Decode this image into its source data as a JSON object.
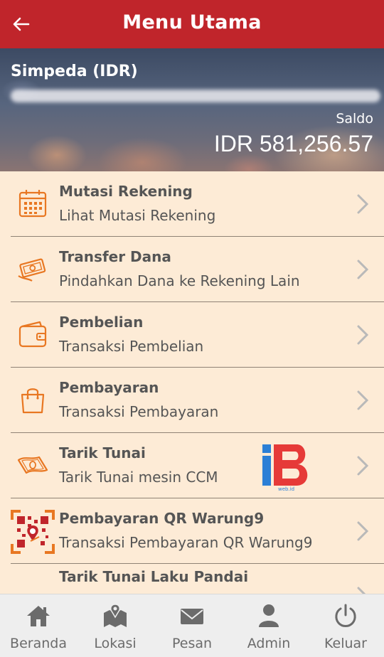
{
  "header": {
    "title": "Menu Utama",
    "back_icon": "arrow-left-icon"
  },
  "account": {
    "name": "Simpeda (IDR)",
    "balance_label": "Saldo",
    "balance_value": "IDR 581,256.57"
  },
  "menu": [
    {
      "title": "Mutasi Rekening",
      "subtitle": "Lihat Mutasi Rekening",
      "icon": "calendar-icon"
    },
    {
      "title": "Transfer Dana",
      "subtitle": "Pindahkan Dana ke Rekening Lain",
      "icon": "money-transfer-icon"
    },
    {
      "title": "Pembelian",
      "subtitle": "Transaksi Pembelian",
      "icon": "wallet-icon"
    },
    {
      "title": "Pembayaran",
      "subtitle": "Transaksi Pembayaran",
      "icon": "shopping-bag-icon"
    },
    {
      "title": "Tarik Tunai",
      "subtitle": "Tarik Tunai mesin CCM",
      "icon": "cash-icon"
    },
    {
      "title": "Pembayaran QR Warung9",
      "subtitle": "Transaksi Pembayaran QR Warung9",
      "icon": "qr-warung9-icon"
    },
    {
      "title": "Tarik Tunai Laku Pandai",
      "subtitle": "",
      "icon": "cash-icon"
    }
  ],
  "tabs": [
    {
      "label": "Beranda",
      "icon": "home-icon"
    },
    {
      "label": "Lokasi",
      "icon": "map-icon"
    },
    {
      "label": "Pesan",
      "icon": "mail-icon"
    },
    {
      "label": "Admin",
      "icon": "user-icon"
    },
    {
      "label": "Keluar",
      "icon": "power-icon"
    }
  ],
  "colors": {
    "header": "#c0252b",
    "icon_orange": "#e87722",
    "background": "#fdebd6"
  }
}
